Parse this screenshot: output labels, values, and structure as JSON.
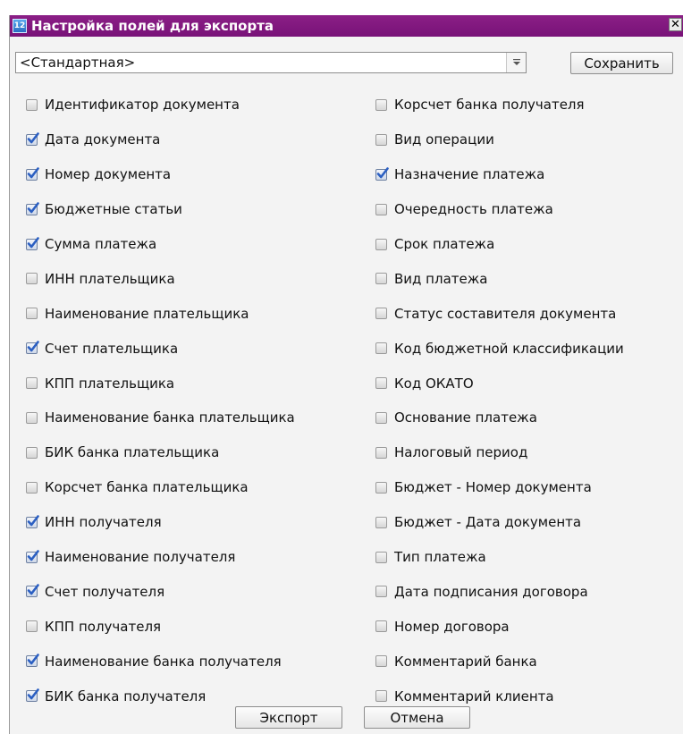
{
  "window": {
    "title": "Настройка полей для экспорта",
    "app_icon_glyph": "12",
    "close_glyph": "✕"
  },
  "template_select": {
    "value": "<Стандартная>"
  },
  "buttons": {
    "save": "Сохранить",
    "export": "Экспорт",
    "cancel": "Отмена"
  },
  "colors": {
    "titlebar": "#7d1680",
    "check_mark": "#2b5fc2"
  },
  "fields_left": [
    {
      "label": "Идентификатор документа",
      "checked": false
    },
    {
      "label": "Дата документа",
      "checked": true
    },
    {
      "label": "Номер документа",
      "checked": true
    },
    {
      "label": "Бюджетные статьи",
      "checked": true
    },
    {
      "label": "Сумма платежа",
      "checked": true
    },
    {
      "label": "ИНН плательщика",
      "checked": false
    },
    {
      "label": "Наименование плательщика",
      "checked": false
    },
    {
      "label": "Счет плательщика",
      "checked": true
    },
    {
      "label": "КПП плательщика",
      "checked": false
    },
    {
      "label": "Наименование банка плательщика",
      "checked": false
    },
    {
      "label": "БИК банка плательщика",
      "checked": false
    },
    {
      "label": "Корсчет банка плательщика",
      "checked": false
    },
    {
      "label": "ИНН получателя",
      "checked": true
    },
    {
      "label": "Наименование получателя",
      "checked": true
    },
    {
      "label": "Счет получателя",
      "checked": true
    },
    {
      "label": "КПП получателя",
      "checked": false
    },
    {
      "label": "Наименование банка получателя",
      "checked": true
    },
    {
      "label": "БИК банка получателя",
      "checked": true
    }
  ],
  "fields_right": [
    {
      "label": "Корсчет банка получателя",
      "checked": false
    },
    {
      "label": "Вид операции",
      "checked": false
    },
    {
      "label": "Назначение платежа",
      "checked": true
    },
    {
      "label": "Очередность платежа",
      "checked": false
    },
    {
      "label": "Срок платежа",
      "checked": false
    },
    {
      "label": "Вид платежа",
      "checked": false
    },
    {
      "label": "Статус составителя документа",
      "checked": false
    },
    {
      "label": "Код бюджетной классификации",
      "checked": false
    },
    {
      "label": "Код ОКАТО",
      "checked": false
    },
    {
      "label": "Основание платежа",
      "checked": false
    },
    {
      "label": "Налоговый период",
      "checked": false
    },
    {
      "label": "Бюджет - Номер документа",
      "checked": false
    },
    {
      "label": "Бюджет - Дата документа",
      "checked": false
    },
    {
      "label": "Тип платежа",
      "checked": false
    },
    {
      "label": "Дата подписания договора",
      "checked": false
    },
    {
      "label": "Номер договора",
      "checked": false
    },
    {
      "label": "Комментарий банка",
      "checked": false
    },
    {
      "label": "Комментарий клиента",
      "checked": false
    }
  ]
}
